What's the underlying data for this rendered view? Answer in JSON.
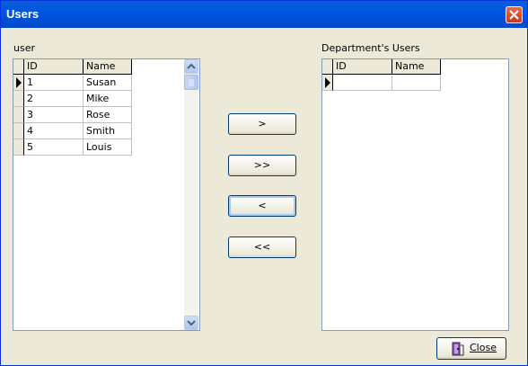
{
  "window": {
    "title": "Users"
  },
  "left": {
    "label": "user",
    "columns": [
      "ID",
      "Name"
    ],
    "rows": [
      {
        "id": "1",
        "name": "Susan"
      },
      {
        "id": "2",
        "name": "Mike"
      },
      {
        "id": "3",
        "name": "Rose"
      },
      {
        "id": "4",
        "name": "Smith"
      },
      {
        "id": "5",
        "name": "Louis"
      }
    ]
  },
  "right": {
    "label": "Department's Users",
    "columns": [
      "ID",
      "Name"
    ]
  },
  "buttons": {
    "move_one": ">",
    "move_all": ">>",
    "remove_one": "<",
    "remove_all": "<<",
    "close": "Close"
  },
  "icons": {
    "close_x": "close-icon",
    "close_button": "exit-door-icon",
    "row_pointer": "row-pointer-icon"
  }
}
